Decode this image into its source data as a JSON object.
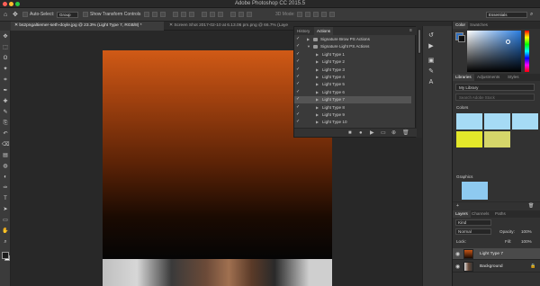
{
  "app": {
    "title": "Adobe Photoshop CC 2015.5",
    "workspace": "Essentials"
  },
  "options_bar": {
    "auto_select_label": "Auto-Select:",
    "auto_select_value": "Group",
    "transform_label": "Show Transform Controls",
    "mode_label": "3D Mode:"
  },
  "document_tabs": [
    {
      "label": "bs2pngaltiemer-seth-doyle.jpg @ 23.3% (Light Type 7, RGB/8) *",
      "active": true
    },
    {
      "label": "Screen Shot 2017-02-10 at 6.13.06 pm.png @ 66.7% (Laye",
      "active": false
    }
  ],
  "tools": [
    "move-icon",
    "marquee-icon",
    "lasso-icon",
    "quick-select-icon",
    "crop-icon",
    "eyedropper-icon",
    "healing-icon",
    "brush-icon",
    "clone-stamp-icon",
    "history-brush-icon",
    "eraser-icon",
    "gradient-icon",
    "blur-icon",
    "dodge-icon",
    "pen-icon",
    "type-icon",
    "path-select-icon",
    "shape-icon",
    "hand-icon",
    "zoom-icon"
  ],
  "actions_panel": {
    "tabs": [
      "History",
      "Actions"
    ],
    "active_tab": "Actions",
    "rows": [
      {
        "label": "Signature Brow PS Actions",
        "indent": 0,
        "folder": true,
        "open": false,
        "selected": false
      },
      {
        "label": "Signature Light PS Actions",
        "indent": 0,
        "folder": true,
        "open": true,
        "selected": false
      },
      {
        "label": "Light Type 1",
        "indent": 1,
        "folder": false,
        "selected": false
      },
      {
        "label": "Light Type 2",
        "indent": 1,
        "folder": false,
        "selected": false
      },
      {
        "label": "Light Type 3",
        "indent": 1,
        "folder": false,
        "selected": false
      },
      {
        "label": "Light Type 4",
        "indent": 1,
        "folder": false,
        "selected": false
      },
      {
        "label": "Light Type 5",
        "indent": 1,
        "folder": false,
        "selected": false
      },
      {
        "label": "Light Type 6",
        "indent": 1,
        "folder": false,
        "selected": false
      },
      {
        "label": "Light Type 7",
        "indent": 1,
        "folder": false,
        "selected": true
      },
      {
        "label": "Light Type 8",
        "indent": 1,
        "folder": false,
        "selected": false
      },
      {
        "label": "Light Type 9",
        "indent": 1,
        "folder": false,
        "selected": false
      },
      {
        "label": "Light Type 10",
        "indent": 1,
        "folder": false,
        "selected": false
      }
    ],
    "footer_icons": [
      "stop-icon",
      "record-icon",
      "play-icon",
      "new-set-icon",
      "new-action-icon",
      "delete-icon"
    ]
  },
  "right_panel": {
    "color_tabs": [
      "Color",
      "Swatches"
    ],
    "libraries_tabs": [
      "Libraries",
      "Adjustments",
      "Styles"
    ],
    "library_name": "My Library",
    "search_placeholder": "Search Adobe Stock",
    "colors_label": "Colors",
    "graphics_label": "Graphics",
    "swatches": [
      "#a6dbf5",
      "#a6dbf5",
      "#a6dbf5",
      "#e3e72a",
      "#d5d66a"
    ],
    "graphic_color": "#8ecaf0",
    "layers_tabs": [
      "Layers",
      "Channels",
      "Paths"
    ],
    "kind_label": "Kind",
    "blend_mode": "Normal",
    "opacity_label": "Opacity:",
    "opacity_value": "100%",
    "lock_label": "Lock:",
    "fill_label": "Fill:",
    "fill_value": "100%",
    "layers": [
      {
        "name": "Light Type 7",
        "selected": true
      },
      {
        "name": "Background",
        "selected": false
      }
    ]
  },
  "colors": {
    "foreground": "#1c1c1c",
    "background": "#ffffff",
    "doc_gradient_top": "#d05a16",
    "doc_gradient_bottom": "#050505"
  }
}
